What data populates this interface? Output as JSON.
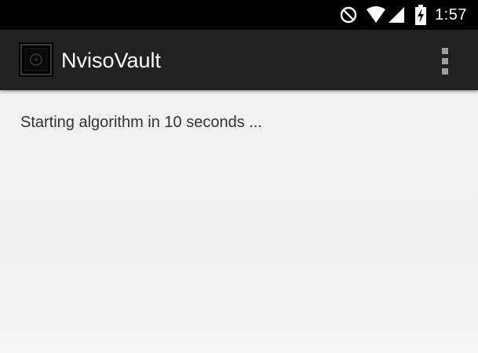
{
  "status_bar": {
    "time": "1:57",
    "icons": [
      "do-not-disturb-icon",
      "wifi-icon",
      "signal-icon",
      "battery-charging-icon"
    ]
  },
  "app_bar": {
    "title": "NvisoVault",
    "icon": "nviso-vault-app-icon",
    "menu_icon": "overflow-menu-icon"
  },
  "content": {
    "message": "Starting algorithm in 10 seconds ..."
  },
  "colors": {
    "status_bar": "#000000",
    "app_bar": "#212121",
    "background": "#f2f2f2",
    "text": "#333333"
  }
}
